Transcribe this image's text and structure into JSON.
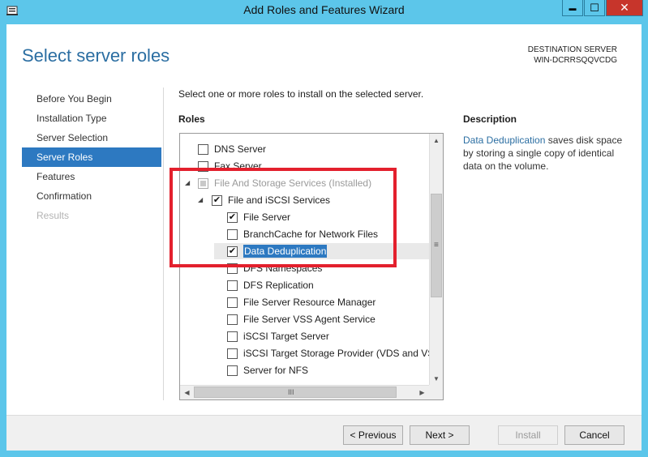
{
  "window": {
    "title": "Add Roles and Features Wizard",
    "minimize_glyph": "▬",
    "maximize_glyph": "☐",
    "close_glyph": "✕"
  },
  "header": {
    "page_title": "Select server roles",
    "destination_label": "DESTINATION SERVER",
    "destination_server": "WIN-DCRRSQQVCDG"
  },
  "nav": {
    "items": [
      {
        "label": "Before You Begin",
        "state": "normal"
      },
      {
        "label": "Installation Type",
        "state": "normal"
      },
      {
        "label": "Server Selection",
        "state": "normal"
      },
      {
        "label": "Server Roles",
        "state": "active"
      },
      {
        "label": "Features",
        "state": "normal"
      },
      {
        "label": "Confirmation",
        "state": "normal"
      },
      {
        "label": "Results",
        "state": "disabled"
      }
    ]
  },
  "main": {
    "instruction": "Select one or more roles to install on the selected server.",
    "roles_heading": "Roles",
    "roles": [
      {
        "label": "DNS Server",
        "checked": false
      },
      {
        "label": "Fax Server",
        "checked": false
      },
      {
        "label": "File And Storage Services (Installed)",
        "checked": "indeterminate-grey",
        "expanded": true
      },
      {
        "label": "File and iSCSI Services",
        "checked": true,
        "expanded": true
      },
      {
        "label": "File Server",
        "checked": true
      },
      {
        "label": "BranchCache for Network Files",
        "checked": false
      },
      {
        "label": "Data Deduplication",
        "checked": true,
        "selected": true
      },
      {
        "label": "DFS Namespaces",
        "checked": false
      },
      {
        "label": "DFS Replication",
        "checked": false
      },
      {
        "label": "File Server Resource Manager",
        "checked": false
      },
      {
        "label": "File Server VSS Agent Service",
        "checked": false
      },
      {
        "label": "iSCSI Target Server",
        "checked": false
      },
      {
        "label": "iSCSI Target Storage Provider (VDS and VSS",
        "checked": false
      },
      {
        "label": "Server for NFS",
        "checked": false
      }
    ],
    "check_glyph": "✔",
    "expander_glyph": "◢",
    "vscroll_grip": "≡",
    "hscroll_grip": "III"
  },
  "description": {
    "heading": "Description",
    "link_text": "Data Deduplication",
    "text": " saves disk space by storing a single copy of identical data on the volume."
  },
  "footer": {
    "previous_label": "< Previous",
    "next_label": "Next >",
    "install_label": "Install",
    "cancel_label": "Cancel"
  },
  "colors": {
    "accent": "#2d79c1",
    "title_blue": "#2b6ea2",
    "chrome": "#5cc6ea",
    "close_red": "#c7352b",
    "annotation_red": "#e3202d"
  }
}
